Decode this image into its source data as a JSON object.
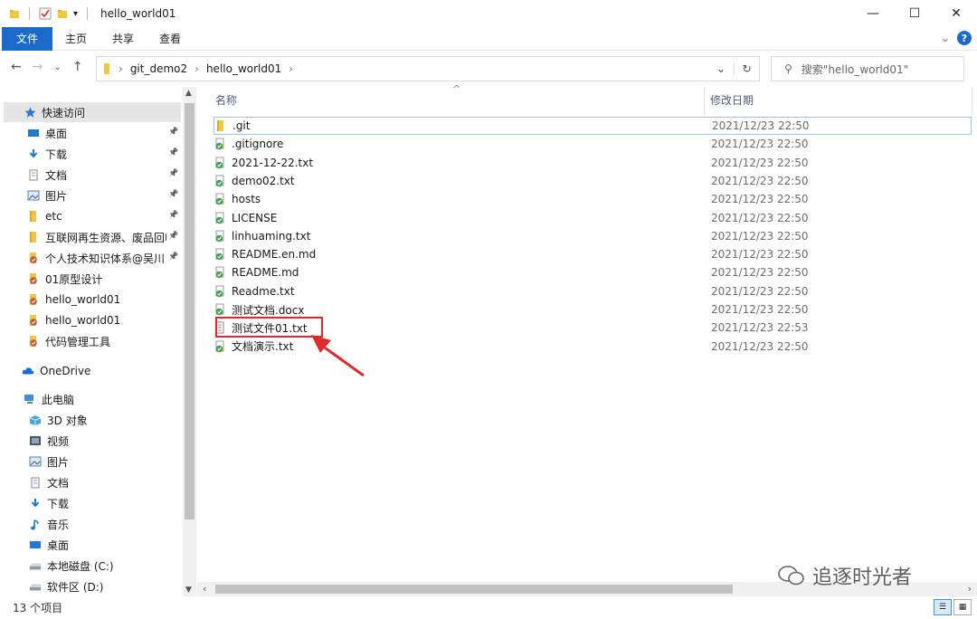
{
  "window": {
    "title": "hello_world01",
    "minimize": "—",
    "maximize": "☐",
    "close": "✕"
  },
  "ribbon": {
    "tabs": [
      "文件",
      "主页",
      "共享",
      "查看"
    ],
    "expand": "⌄",
    "help": "?"
  },
  "address": {
    "crumbs": [
      "git_demo2",
      "hello_world01"
    ],
    "search_placeholder": "搜索\"hello_world01\""
  },
  "nav_pane": {
    "quick_access": "快速访问",
    "quick_items": [
      {
        "label": "桌面",
        "icon": "desktop-icon",
        "pinned": true
      },
      {
        "label": "下载",
        "icon": "download-icon",
        "pinned": true
      },
      {
        "label": "文档",
        "icon": "document-icon",
        "pinned": true
      },
      {
        "label": "图片",
        "icon": "picture-icon",
        "pinned": true
      },
      {
        "label": "etc",
        "icon": "folder-icon",
        "pinned": true
      },
      {
        "label": "互联网再生资源、废品回收",
        "icon": "folder-icon",
        "pinned": true
      },
      {
        "label": "个人技术知识体系@吴川",
        "icon": "git-folder-icon",
        "pinned": true
      },
      {
        "label": "01原型设计",
        "icon": "git-folder-icon",
        "pinned": false
      },
      {
        "label": "hello_world01",
        "icon": "git-folder-icon",
        "pinned": false
      },
      {
        "label": "hello_world01",
        "icon": "git-folder-icon",
        "pinned": false
      },
      {
        "label": "代码管理工具",
        "icon": "git-folder-icon",
        "pinned": false
      }
    ],
    "onedrive": "OneDrive",
    "this_pc": "此电脑",
    "pc_items": [
      {
        "label": "3D 对象",
        "icon": "3d-objects-icon"
      },
      {
        "label": "视频",
        "icon": "video-icon"
      },
      {
        "label": "图片",
        "icon": "picture-icon"
      },
      {
        "label": "文档",
        "icon": "document-icon"
      },
      {
        "label": "下载",
        "icon": "download-icon"
      },
      {
        "label": "音乐",
        "icon": "music-icon"
      },
      {
        "label": "桌面",
        "icon": "desktop-icon"
      },
      {
        "label": "本地磁盘 (C:)",
        "icon": "drive-icon"
      },
      {
        "label": "软件区 (D:)",
        "icon": "drive-icon"
      }
    ]
  },
  "file_list": {
    "col_name": "名称",
    "col_date": "修改日期",
    "files": [
      {
        "name": ".git",
        "date": "2021/12/23 22:50",
        "icon": "folder-icon"
      },
      {
        "name": ".gitignore",
        "date": "2021/12/23 22:50",
        "icon": "git-file-icon"
      },
      {
        "name": "2021-12-22.txt",
        "date": "2021/12/23 22:50",
        "icon": "git-file-icon"
      },
      {
        "name": "demo02.txt",
        "date": "2021/12/23 22:50",
        "icon": "git-file-icon"
      },
      {
        "name": "hosts",
        "date": "2021/12/23 22:50",
        "icon": "git-file-icon"
      },
      {
        "name": "LICENSE",
        "date": "2021/12/23 22:50",
        "icon": "git-file-icon"
      },
      {
        "name": "linhuaming.txt",
        "date": "2021/12/23 22:50",
        "icon": "git-file-icon"
      },
      {
        "name": "README.en.md",
        "date": "2021/12/23 22:50",
        "icon": "git-file-icon"
      },
      {
        "name": "README.md",
        "date": "2021/12/23 22:50",
        "icon": "git-file-icon"
      },
      {
        "name": "Readme.txt",
        "date": "2021/12/23 22:50",
        "icon": "git-file-icon"
      },
      {
        "name": "测试文档.docx",
        "date": "2021/12/23 22:50",
        "icon": "git-file-icon"
      },
      {
        "name": "测试文件01.txt",
        "date": "2021/12/23 22:53",
        "icon": "text-file-icon"
      },
      {
        "name": "文档演示.txt",
        "date": "2021/12/23 22:50",
        "icon": "git-file-icon"
      }
    ]
  },
  "status": {
    "count": "13 个项目"
  },
  "watermark": "追逐时光者",
  "colors": {
    "accent": "#1b6ac9",
    "highlight": "#e0292c",
    "git_green": "#3fa24a"
  }
}
